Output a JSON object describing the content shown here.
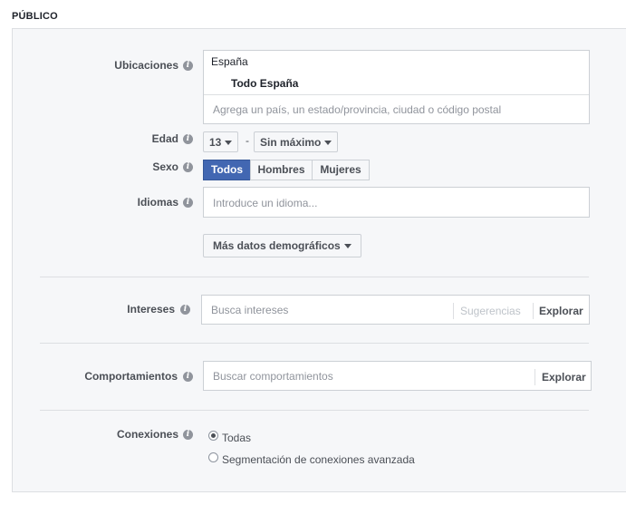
{
  "section_title": "PÚBLICO",
  "ubicaciones": {
    "label": "Ubicaciones",
    "country": "España",
    "selected": "Todo España",
    "placeholder": "Agrega un país, un estado/provincia, ciudad o código postal"
  },
  "edad": {
    "label": "Edad",
    "min": "13",
    "separator": "-",
    "max": "Sin máximo"
  },
  "sexo": {
    "label": "Sexo",
    "options": [
      "Todos",
      "Hombres",
      "Mujeres"
    ],
    "selected": "Todos"
  },
  "idiomas": {
    "label": "Idiomas",
    "placeholder": "Introduce un idioma..."
  },
  "mas_datos": {
    "label": "Más datos demográficos"
  },
  "intereses": {
    "label": "Intereses",
    "placeholder": "Busca intereses",
    "suggestions": "Sugerencias",
    "explore": "Explorar"
  },
  "comportamientos": {
    "label": "Comportamientos",
    "placeholder": "Buscar comportamientos",
    "explore": "Explorar"
  },
  "conexiones": {
    "label": "Conexiones",
    "options": [
      "Todas",
      "Segmentación de conexiones avanzada"
    ],
    "selected": "Todas"
  },
  "colors": {
    "accent": "#4267b2",
    "panel_bg": "#f6f7f9",
    "border": "#ccd0d5"
  },
  "icons": {
    "info": "info-icon",
    "caret": "caret-down-icon"
  }
}
